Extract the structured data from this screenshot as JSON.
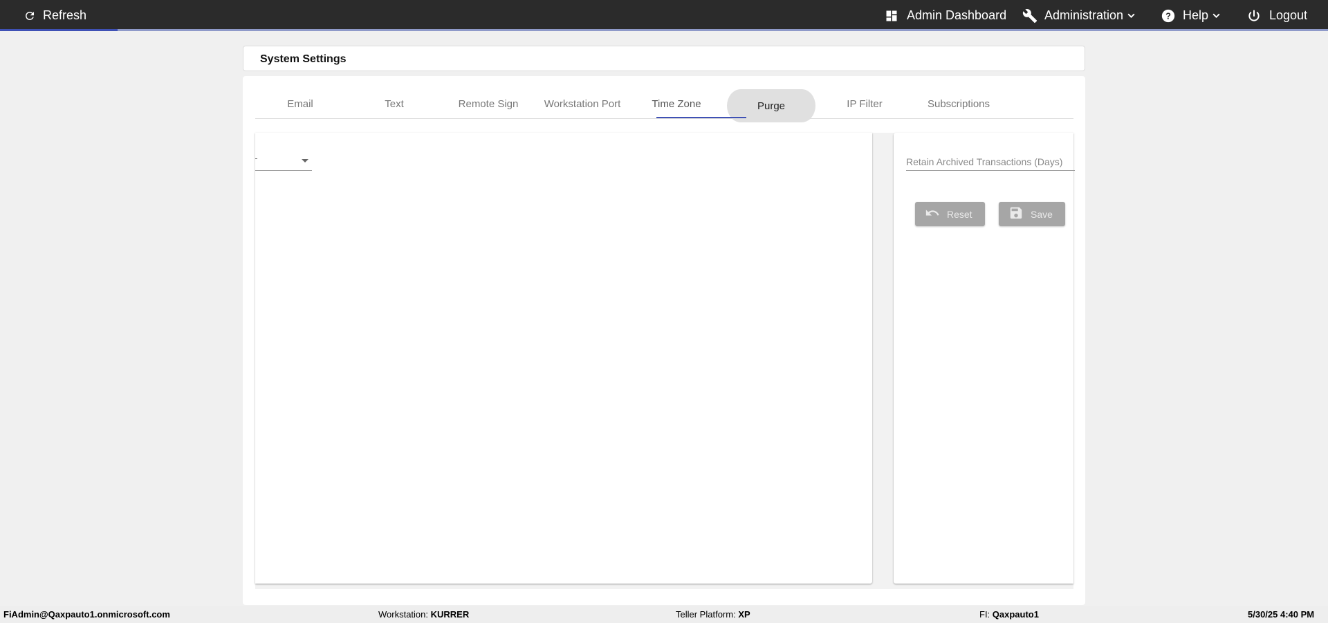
{
  "topbar": {
    "refresh_label": "Refresh",
    "admin_dashboard_label": "Admin Dashboard",
    "administration_label": "Administration",
    "help_label": "Help",
    "logout_label": "Logout",
    "loading_progress_fraction": 0.0885,
    "colors": {
      "background": "#2b2b2b",
      "accent": "#3f51b5"
    }
  },
  "page": {
    "title": "System Settings"
  },
  "tabs": [
    {
      "label": "Email"
    },
    {
      "label": "Text"
    },
    {
      "label": "Remote Sign"
    },
    {
      "label": "Workstation Port"
    },
    {
      "label": "Time Zone"
    },
    {
      "label": "Purge"
    },
    {
      "label": "IP Filter"
    },
    {
      "label": "Subscriptions"
    }
  ],
  "active_tab": "Time Zone",
  "hovered_tab": "Purge",
  "purge": {
    "retain_label": "Retain Archived Transactions (Days)",
    "reset_label": "Reset",
    "save_label": "Save"
  },
  "footer": {
    "user": "FiAdmin@Qaxpauto1.onmicrosoft.com",
    "workstation_label": "Workstation: ",
    "workstation_value": "KURRER",
    "teller_label": "Teller Platform: ",
    "teller_value": "XP",
    "fi_label": "FI: ",
    "fi_value": "Qaxpauto1",
    "datetime": "5/30/25 4:40 PM"
  }
}
